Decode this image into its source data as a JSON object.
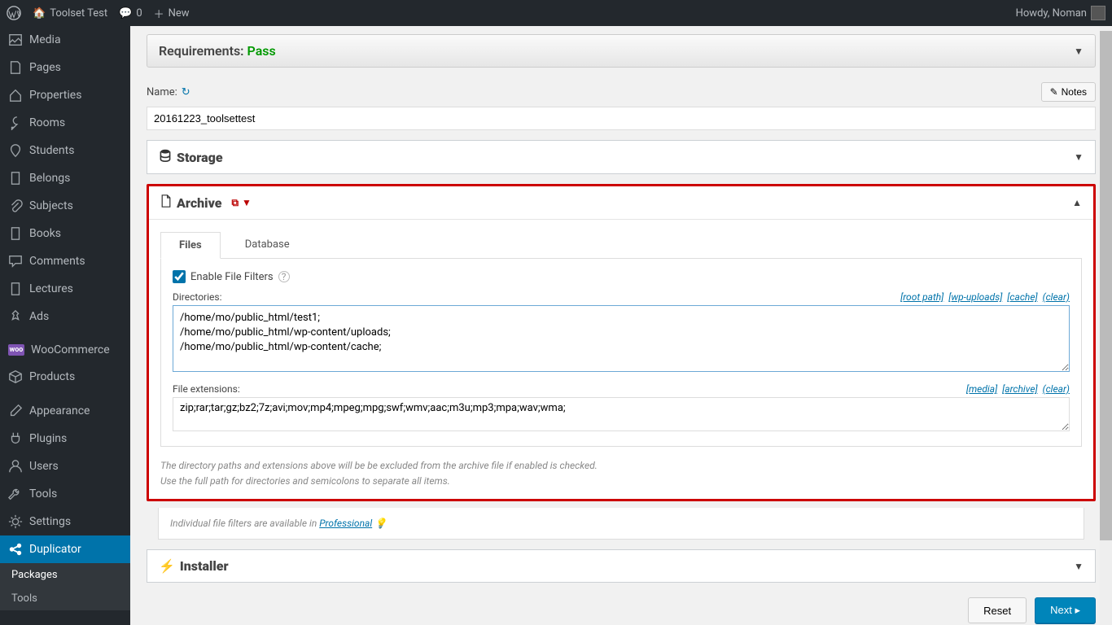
{
  "adminbar": {
    "site_title": "Toolset Test",
    "comments": "0",
    "new": "New",
    "howdy": "Howdy, Noman"
  },
  "sidebar": {
    "items": [
      {
        "label": "Media",
        "icon": "🖼"
      },
      {
        "label": "Pages",
        "icon": "📄"
      },
      {
        "label": "Properties",
        "icon": "🏠"
      },
      {
        "label": "Rooms",
        "icon": "🔑"
      },
      {
        "label": "Students",
        "icon": "📍"
      },
      {
        "label": "Belongs",
        "icon": "📕"
      },
      {
        "label": "Subjects",
        "icon": "📎"
      },
      {
        "label": "Books",
        "icon": "📘"
      },
      {
        "label": "Comments",
        "icon": "💬"
      },
      {
        "label": "Lectures",
        "icon": "📙"
      },
      {
        "label": "Ads",
        "icon": "📌"
      },
      {
        "label": "WooCommerce",
        "icon": "woo"
      },
      {
        "label": "Products",
        "icon": "📦"
      },
      {
        "label": "Appearance",
        "icon": "🖌"
      },
      {
        "label": "Plugins",
        "icon": "🔌"
      },
      {
        "label": "Users",
        "icon": "👤"
      },
      {
        "label": "Tools",
        "icon": "🔧"
      },
      {
        "label": "Settings",
        "icon": "⚙"
      }
    ],
    "active": {
      "label": "Duplicator",
      "icon": "🔗"
    },
    "sub": [
      {
        "label": "Packages",
        "current": true
      },
      {
        "label": "Tools",
        "current": false
      }
    ]
  },
  "requirements": {
    "label": "Requirements:",
    "status": "Pass"
  },
  "name": {
    "label": "Name:",
    "value": "20161223_toolsettest",
    "notes": "Notes"
  },
  "storage": {
    "title": "Storage"
  },
  "archive": {
    "title": "Archive",
    "tabs": {
      "files": "Files",
      "database": "Database"
    },
    "enable_label": "Enable File Filters",
    "dirs_label": "Directories:",
    "dirs_links": {
      "root": "[root path]",
      "uploads": "[wp-uploads]",
      "cache": "[cache]",
      "clear": "(clear)"
    },
    "dirs_value": "/home/mo/public_html/test1;\n/home/mo/public_html/wp-content/uploads;\n/home/mo/public_html/wp-content/cache;",
    "ext_label": "File extensions:",
    "ext_links": {
      "media": "[media]",
      "archive": "[archive]",
      "clear": "(clear)"
    },
    "ext_value": "zip;rar;tar;gz;bz2;7z;avi;mov;mp4;mpeg;mpg;swf;wmv;aac;m3u;mp3;mpa;wav;wma;",
    "hint1": "The directory paths and extensions above will be be excluded from the archive file if enabled is checked.",
    "hint2": "Use the full path for directories and semicolons to separate all items.",
    "pro_text": "Individual file filters are available in ",
    "pro_link": "Professional"
  },
  "installer": {
    "title": "Installer"
  },
  "buttons": {
    "reset": "Reset",
    "next": "Next ▸"
  }
}
